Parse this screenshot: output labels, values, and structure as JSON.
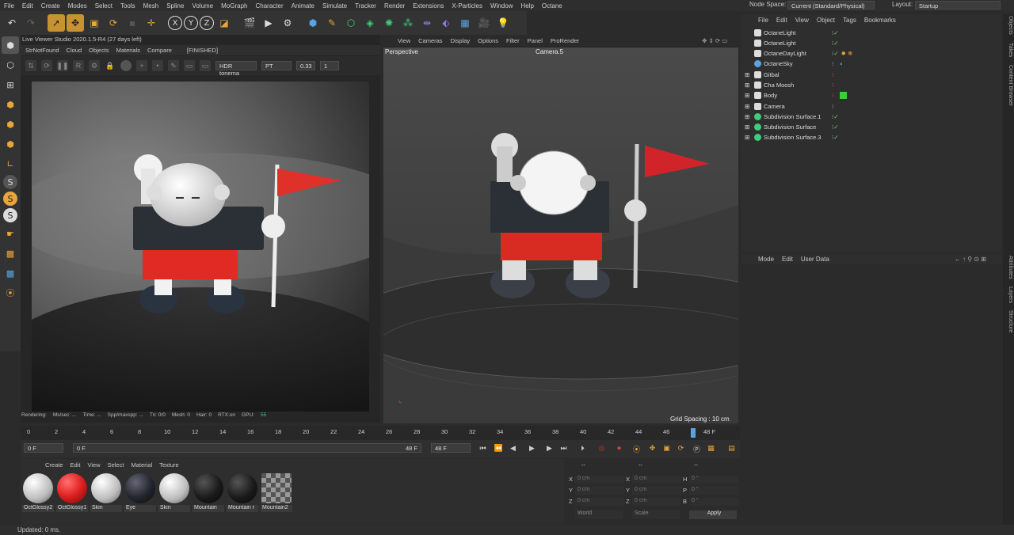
{
  "menu": [
    "File",
    "Edit",
    "Create",
    "Modes",
    "Select",
    "Tools",
    "Mesh",
    "Spline",
    "Volume",
    "MoGraph",
    "Character",
    "Animate",
    "Simulate",
    "Tracker",
    "Render",
    "Extensions",
    "X-Particles",
    "Window",
    "Help",
    "Octane"
  ],
  "node_space": {
    "label": "Node Space:",
    "value": "Current (Standard/Physical)"
  },
  "layout": {
    "label": "Layout:",
    "value": "Startup"
  },
  "live_viewer": {
    "title": "Live Viewer Studio 2020.1.5-R4 (27 days left)",
    "menu": [
      "StrNotFound",
      "Cloud",
      "Objects",
      "Materials",
      "Compare"
    ],
    "state": "[FINISHED]",
    "tonemap": "HDR tonema",
    "kernel": "PT",
    "value1": "0.33",
    "value2": "1",
    "status": [
      "Rendering:",
      "Ms/sec: ...",
      "Time: ...",
      "Spp/maxspp: ...",
      "Tri: 0/0",
      "Mesh: 0",
      "Hair: 0",
      "RTX:on",
      "GPU:",
      "55"
    ]
  },
  "viewport": {
    "menu": [
      "View",
      "Cameras",
      "Display",
      "Options",
      "Filter",
      "Panel",
      "ProRender"
    ],
    "name": "Perspective",
    "camera": "Camera.5",
    "grid": "Grid Spacing : 10 cm"
  },
  "timeline": {
    "ticks": [
      "0",
      "2",
      "4",
      "6",
      "8",
      "10",
      "12",
      "14",
      "16",
      "18",
      "20",
      "22",
      "24",
      "26",
      "28",
      "30",
      "32",
      "34",
      "36",
      "38",
      "40",
      "42",
      "44",
      "46"
    ],
    "current": "48 F",
    "start": "0 F",
    "start2": "0 F",
    "end": "48 F",
    "end2": "48 F"
  },
  "materials": {
    "menu": [
      "Create",
      "Edit",
      "View",
      "Select",
      "Material",
      "Texture"
    ],
    "items": [
      {
        "name": "OctGlossy2",
        "color": "white"
      },
      {
        "name": "OctGlossy1",
        "color": "red"
      },
      {
        "name": "Skin",
        "color": "white"
      },
      {
        "name": "Eye",
        "color": "black"
      },
      {
        "name": "Skin",
        "color": "white"
      },
      {
        "name": "Mountain",
        "color": "black"
      },
      {
        "name": "Mountain r",
        "color": "black"
      },
      {
        "name": "Mountain2",
        "color": "checker"
      }
    ]
  },
  "coords": {
    "header1": "--",
    "header2": "--",
    "header3": "--",
    "rows": [
      {
        "a": "X",
        "av": "0 cm",
        "b": "X",
        "bv": "0 cm",
        "c": "H",
        "cv": "0 °"
      },
      {
        "a": "Y",
        "av": "0 cm",
        "b": "Y",
        "bv": "0 cm",
        "c": "P",
        "cv": "0 °"
      },
      {
        "a": "Z",
        "av": "0 cm",
        "b": "Z",
        "bv": "0 cm",
        "c": "B",
        "cv": "0 °"
      }
    ],
    "world": "World",
    "scale": "Scale",
    "apply": "Apply"
  },
  "object_manager": {
    "menu": [
      "File",
      "Edit",
      "View",
      "Object",
      "Tags",
      "Bookmarks"
    ],
    "objects": [
      {
        "name": "OctaneLight",
        "tag": "light"
      },
      {
        "name": "OctaneLight",
        "tag": "light"
      },
      {
        "name": "OctaneDayLight",
        "tag": "sun"
      },
      {
        "name": "OctaneSky",
        "tag": "sky"
      },
      {
        "name": "Gitbal",
        "tag": ""
      },
      {
        "name": "Cha Moosh",
        "tag": ""
      },
      {
        "name": "Body",
        "tag": "green"
      },
      {
        "name": "Camera",
        "tag": ""
      },
      {
        "name": "Subdivision Surface.1",
        "tag": ""
      },
      {
        "name": "Subdivision Surface",
        "tag": ""
      },
      {
        "name": "Subdivision Surface.3",
        "tag": ""
      }
    ]
  },
  "attributes": {
    "menu": [
      "Mode",
      "Edit",
      "User Data"
    ]
  },
  "right_tabs": [
    "Objects",
    "Takes",
    "Content Browser",
    "Attributes",
    "Layers",
    "Structure"
  ],
  "status_bar": "Updated: 0 ms.",
  "colors": {
    "accent": "#c79330",
    "panel": "#2b2b2b",
    "red_material": "#e01f1f"
  }
}
